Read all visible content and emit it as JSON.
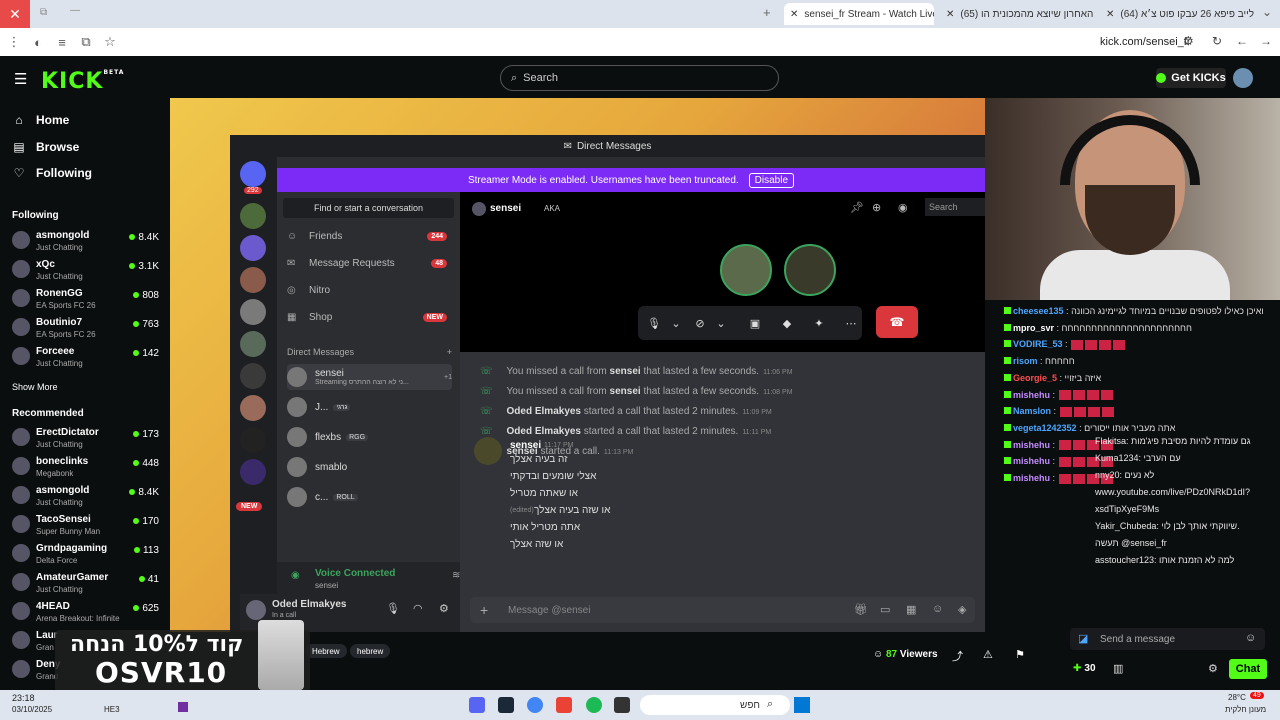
{
  "browser": {
    "tabs": [
      {
        "label": "sensei_fr Stream - Watch Live o",
        "active": true
      },
      {
        "label": "(65) האחרון שיוצא מהמכונית הו",
        "active": false
      },
      {
        "label": "(64) לייב פיפא 26 עבקו פוט צ׳א",
        "active": false
      }
    ],
    "url": "kick.com/sensei_fr"
  },
  "header": {
    "search_placeholder": "Search",
    "get_kicks": "Get KICKs",
    "logo": "KICK",
    "logo_beta": "BETA"
  },
  "sidebar": {
    "nav": [
      {
        "label": "Home",
        "icon": "home-icon"
      },
      {
        "label": "Browse",
        "icon": "browse-icon"
      },
      {
        "label": "Following",
        "icon": "heart-icon"
      }
    ],
    "following_title": "Following",
    "following": [
      {
        "name": "asmongold",
        "category": "Just Chatting",
        "viewers": "8.4K"
      },
      {
        "name": "xQc",
        "category": "Just Chatting",
        "viewers": "3.1K"
      },
      {
        "name": "RonenGG",
        "category": "EA Sports FC 26",
        "viewers": "808"
      },
      {
        "name": "Boutinio7",
        "category": "EA Sports FC 26",
        "viewers": "763"
      },
      {
        "name": "Forceee",
        "category": "Just Chatting",
        "viewers": "142"
      }
    ],
    "show_more": "Show More",
    "recommended_title": "Recommended",
    "recommended": [
      {
        "name": "ErectDictator",
        "category": "Just Chatting",
        "viewers": "173"
      },
      {
        "name": "boneclinks",
        "category": "Megabonk",
        "viewers": "448"
      },
      {
        "name": "asmongold",
        "category": "Just Chatting",
        "viewers": "8.4K"
      },
      {
        "name": "TacoSensei",
        "category": "Super Bunny Man",
        "viewers": "170"
      },
      {
        "name": "Grndpagaming",
        "category": "Delta Force",
        "viewers": "113"
      },
      {
        "name": "AmateurGamer",
        "category": "Just Chatting",
        "viewers": "41"
      },
      {
        "name": "4HEAD",
        "category": "Arena Breakout: Infinite",
        "viewers": "625"
      },
      {
        "name": "Laur",
        "category": "Gran",
        "viewers": ""
      },
      {
        "name": "Deny",
        "category": "Grand",
        "viewers": ""
      }
    ]
  },
  "discord": {
    "title": "Direct Messages",
    "banner": "Streamer Mode is enabled. Usernames have been truncated.",
    "banner_button": "Disable",
    "find": "Find or start a conversation",
    "server_badge": "292",
    "nav": [
      {
        "label": "Friends",
        "badge": "244",
        "icon": "friends-icon"
      },
      {
        "label": "Message Requests",
        "badge": "48",
        "icon": "mail-icon"
      },
      {
        "label": "Nitro",
        "badge": "",
        "icon": "nitro-icon"
      },
      {
        "label": "Shop",
        "badge": "NEW",
        "icon": "shop-icon"
      }
    ],
    "dm_header": "Direct Messages",
    "dms": [
      {
        "name": "sensei",
        "sub": "Streaming ני לא רוצה ההתרס...",
        "extra": "+1"
      },
      {
        "name": "J...",
        "tag": "גרגי"
      },
      {
        "name": "flexbs",
        "tag": "RGG"
      },
      {
        "name": "smablo",
        "tag": ""
      },
      {
        "name": "c...",
        "tag": "ROLL"
      }
    ],
    "new_badge": "NEW",
    "voice_status": "Voice Connected",
    "voice_sub": "sensei",
    "user_name": "Oded Elmakyes",
    "user_sub": "In a call",
    "channel_name": "sensei",
    "aka": "AKA",
    "search": "Search",
    "messages": [
      {
        "text": "You missed a call from",
        "user": "sensei",
        "rest": "that lasted a few seconds.",
        "time": "11:06 PM"
      },
      {
        "text": "You missed a call from",
        "user": "sensei",
        "rest": "that lasted a few seconds.",
        "time": "11:08 PM"
      },
      {
        "user": "Oded Elmakyes",
        "rest": "started a call that lasted 2 minutes.",
        "time": "11:09 PM"
      },
      {
        "user": "Oded Elmakyes",
        "rest": "started a call that lasted 2 minutes.",
        "time": "11:11 PM"
      },
      {
        "user": "sensei",
        "rest": "started a call.",
        "time": "11:13 PM"
      }
    ],
    "chat_author": "sensei",
    "chat_time": "11:17 PM",
    "chat_lines": [
      "זה בעיה אצלך",
      "אצלי שומעים ובדקתי",
      "או שאתה מטריל",
      "או שזה בעיה אצלך",
      "אתה מטריל אותי",
      "או שזה אצלך"
    ],
    "edited": "(edited)",
    "input_placeholder": "Message @sensei"
  },
  "chat": {
    "lines": [
      {
        "user": "cheesee135",
        "color": "#4da6ff",
        "text": "ואיכן כאילו לפטופים שבנויים במיוחד לגיימינג הכוונה"
      },
      {
        "user": "mpro_svr",
        "color": "#ffffff",
        "text": "חחחחחחחחחחחחחחחחחחחחחח"
      },
      {
        "user": "VODIRE_53",
        "color": "#4da6ff",
        "text": ""
      },
      {
        "user": "risom",
        "color": "#4da6ff",
        "text": "חחחחח"
      },
      {
        "user": "Georgie_5",
        "color": "#ff4d4d",
        "text": "איזה ביזויי"
      },
      {
        "user": "mishehu",
        "color": "#c38bff",
        "text": ""
      },
      {
        "user": "Namslon",
        "color": "#4da6ff",
        "text": ""
      },
      {
        "user": "vegeta1242352",
        "color": "#4da6ff",
        "text": "אתה מעביר אותו ייסורים"
      },
      {
        "user": "mishehu",
        "color": "#c38bff",
        "text": ""
      },
      {
        "user": "mishehu",
        "color": "#c38bff",
        "text": ""
      },
      {
        "user": "mishehu",
        "color": "#c38bff",
        "text": ""
      }
    ],
    "overlay_lines": [
      "Flakitsa: גם עומדת להיות מסיבת פיג'מות",
      "Kuma1234: עם הערבי",
      "nny20: לא נעים",
      "www.youtube.com/live/PDz0NRkD1dI?",
      "xsdTipXyeF9Ms",
      "Yakir_Chubeda: שיווקתי אותך לבן לוי.",
      "תעשה @sensei_fr",
      "asstoucher123: למה לא הזמנת אותו"
    ],
    "send_placeholder": "Send a message",
    "points": "30",
    "chat_button": "Chat"
  },
  "stream": {
    "viewers_count": "87",
    "viewers_label": "Viewers",
    "tags": [
      "Hebrew",
      "hebrew"
    ],
    "promo_line1": "קוד ל10% הנחה",
    "promo_line2": "OSVR10"
  },
  "taskbar": {
    "time": "23:18",
    "date": "03/10/2025",
    "lang": "HE3",
    "search": "חפש",
    "weather_temp": "28°C",
    "weather_desc": "מעונן חלקית",
    "notif_count": "49"
  }
}
